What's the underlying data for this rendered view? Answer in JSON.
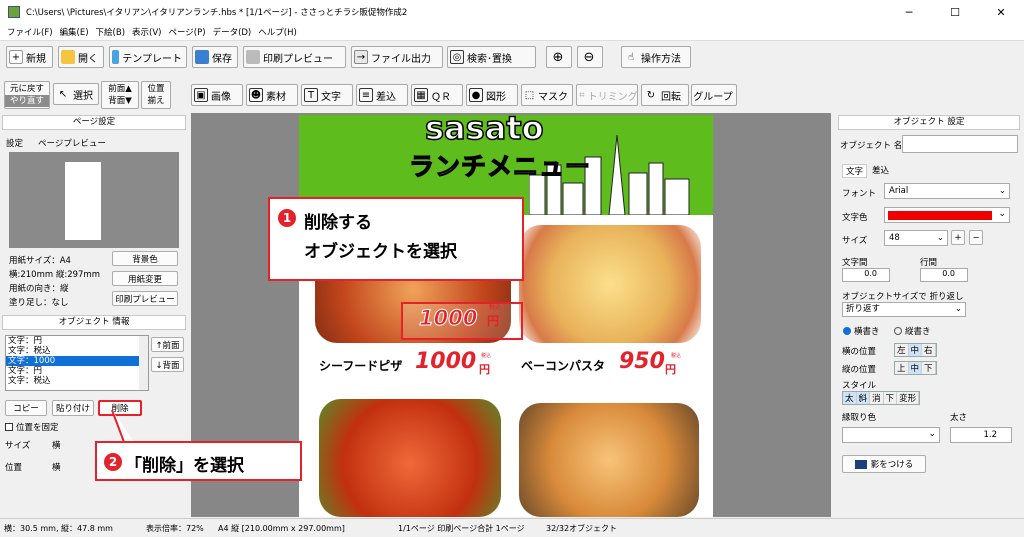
{
  "titlebar": {
    "path": "C:\\Users\\              \\Pictures\\イタリアン\\イタリアンランチ.hbs *  [1/1ページ] - ささっとチラシ販促物作成2",
    "minimize": "─",
    "maximize": "☐",
    "close": "✕"
  },
  "menu": [
    "ファイル(F)",
    "編集(E)",
    "下絵(B)",
    "表示(V)",
    "ページ(P)",
    "データ(D)",
    "ヘルプ(H)"
  ],
  "toolbar1": {
    "new": "新規",
    "open": "開く",
    "template": "テンプレート",
    "save": "保存",
    "print_preview": "印刷プレビュー",
    "file_output": "ファイル出力",
    "search_replace": "検索･置換",
    "zoom_in": "⊕",
    "zoom_out": "⊖",
    "howto": "操作方法"
  },
  "toolbar2": {
    "undo": "元に戻す",
    "redo": "やり直す",
    "select": "選択",
    "front": "前面▲",
    "back": "背面▼",
    "pos": "位置",
    "align": "揃え",
    "image": "画像",
    "material": "素材",
    "text": "文字",
    "merge": "差込",
    "qr": "ＱＲ",
    "shape": "図形",
    "mask": "マスク",
    "trim": "トリミング",
    "rotate": "回転",
    "group": "グループ"
  },
  "left_panel": {
    "page_settings_title": "ページ設定",
    "tab_settings": "設定",
    "tab_preview": "ページプレビュー",
    "paper_size": "用紙サイズ：A4",
    "dims": "横:210mm 縦:297mm",
    "orientation": "用紙の向き：縦",
    "bleed": "塗り足し：なし",
    "bg_color_btn": "背景色",
    "paper_change_btn": "用紙変更",
    "print_preview_btn": "印刷プレビュー",
    "object_info_title": "オブジェクト 情報",
    "list": [
      "文字：円",
      "文字：税込",
      "文字：1000",
      "文字：円",
      "文字：税込"
    ],
    "selected_index": 2,
    "front_btn": "↑前面",
    "back_btn": "↓背面",
    "copy_btn": "コピー",
    "paste_btn": "貼り付け",
    "delete_btn": "削除",
    "fix_pos": "位置を固定",
    "size_label": "サイズ",
    "pos_label": "位置",
    "w_label": "横"
  },
  "canvas": {
    "title_logo": "sasato",
    "subtitle": "ランチメニュー",
    "item1_name": "シーフードピザ",
    "item1_price": "1000",
    "item1_unit": "円",
    "item1_tax": "税込",
    "item2_name": "ベーコンパスタ",
    "item2_price": "950",
    "item2_unit": "円",
    "item2_tax": "税込",
    "selected_price": "1000",
    "selected_unit": "円",
    "selected_tax": "税込"
  },
  "callouts": {
    "c1_num": "1",
    "c1_line1": "削除する",
    "c1_line2": "オブジェクトを選択",
    "c2_num": "2",
    "c2_text": "「削除」を選択",
    "accent": "#e3222b"
  },
  "right_panel": {
    "title": "オブジェクト 設定",
    "name_label": "オブジェクト 名",
    "tab_text": "文字",
    "tab_merge": "差込",
    "font_label": "フォント",
    "font_value": "Arial",
    "color_label": "文字色",
    "color_value": "#ee0000",
    "size_label": "サイズ",
    "size_value": "48",
    "plus": "+",
    "minus": "−",
    "char_spacing": "文字間",
    "line_spacing": "行間",
    "char_spacing_value": "0.0",
    "line_spacing_value": "0.0",
    "fit_label": "オブジェクトサイズで 折り返し",
    "fit_value": "折り返す",
    "horizontal": "横書き",
    "vertical": "縦書き",
    "h_pos": "横の位置",
    "h_opts": [
      "左",
      "中",
      "右"
    ],
    "v_pos": "縦の位置",
    "v_opts": [
      "上",
      "中",
      "下"
    ],
    "style_label": "スタイル",
    "style_opts": [
      "太",
      "斜",
      "消",
      "下",
      "変形"
    ],
    "border_color_label": "縁取り色",
    "thickness_label": "太さ",
    "thickness_value": "1.2",
    "shadow_btn": "影をつける"
  },
  "statusbar": {
    "coords": "横：30.5 mm, 縦：47.8 mm",
    "zoom": "表示倍率：72%",
    "paper": "A4 縦 [210.00mm x 297.00mm]",
    "pages": "1/1ページ 印刷ページ合計 1ページ",
    "objects": "32/32オブジェクト"
  }
}
